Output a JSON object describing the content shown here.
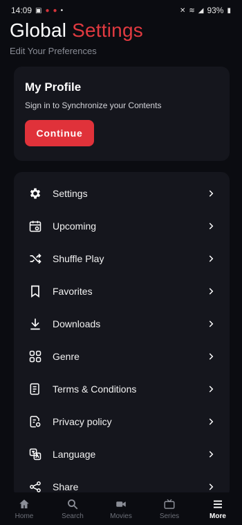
{
  "status_bar": {
    "time": "14:09",
    "battery": "93%"
  },
  "header": {
    "title_part1": "Global",
    "title_part2": "Settings",
    "subtitle": "Edit Your Preferences"
  },
  "profile": {
    "title": "My Profile",
    "description": "Sign in to Synchronize your Contents",
    "button_label": "Continue"
  },
  "menu": {
    "items": [
      {
        "label": "Settings",
        "icon": "gear-icon"
      },
      {
        "label": "Upcoming",
        "icon": "calendar-icon"
      },
      {
        "label": "Shuffle Play",
        "icon": "shuffle-icon"
      },
      {
        "label": "Favorites",
        "icon": "bookmark-icon"
      },
      {
        "label": "Downloads",
        "icon": "download-icon"
      },
      {
        "label": "Genre",
        "icon": "grid-icon"
      },
      {
        "label": "Terms & Conditions",
        "icon": "document-icon"
      },
      {
        "label": "Privacy policy",
        "icon": "privacy-document-icon"
      },
      {
        "label": "Language",
        "icon": "translate-icon"
      },
      {
        "label": "Share",
        "icon": "share-icon"
      }
    ]
  },
  "bottom_nav": {
    "items": [
      {
        "label": "Home",
        "icon": "home-icon",
        "active": false
      },
      {
        "label": "Search",
        "icon": "search-icon",
        "active": false
      },
      {
        "label": "Movies",
        "icon": "movie-camera-icon",
        "active": false
      },
      {
        "label": "Series",
        "icon": "tv-icon",
        "active": false
      },
      {
        "label": "More",
        "icon": "menu-icon",
        "active": true
      }
    ]
  },
  "colors": {
    "accent": "#e0323a",
    "background": "#0b0c11",
    "card": "#15161d"
  }
}
